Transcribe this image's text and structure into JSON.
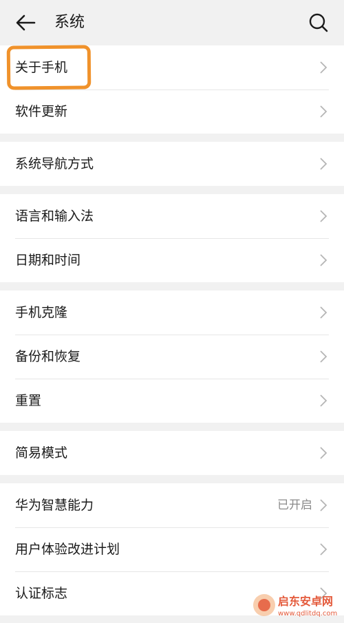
{
  "header": {
    "title": "系统"
  },
  "groups": [
    {
      "items": [
        {
          "label": "关于手机"
        },
        {
          "label": "软件更新"
        }
      ]
    },
    {
      "items": [
        {
          "label": "系统导航方式"
        }
      ]
    },
    {
      "items": [
        {
          "label": "语言和输入法"
        },
        {
          "label": "日期和时间"
        }
      ]
    },
    {
      "items": [
        {
          "label": "手机克隆"
        },
        {
          "label": "备份和恢复"
        },
        {
          "label": "重置"
        }
      ]
    },
    {
      "items": [
        {
          "label": "简易模式"
        }
      ]
    },
    {
      "items": [
        {
          "label": "华为智慧能力",
          "value": "已开启"
        },
        {
          "label": "用户体验改进计划"
        },
        {
          "label": "认证标志"
        }
      ]
    }
  ],
  "watermark": {
    "text": "启东安卓网",
    "url": "www.qdlitdq.com"
  },
  "colors": {
    "annotation": "#f0922b",
    "background": "#f1f1f1",
    "watermark": "#e45a3b"
  }
}
